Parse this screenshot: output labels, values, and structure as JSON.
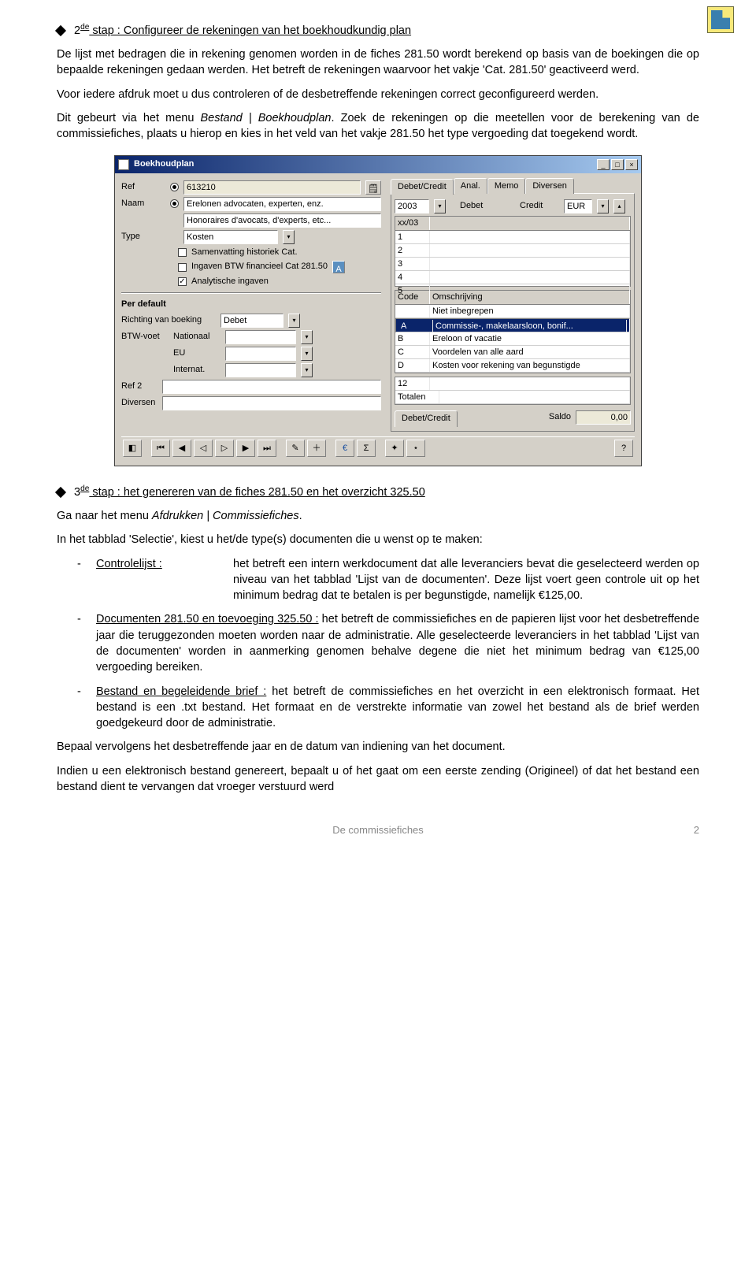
{
  "page_icon": "document-tools-icon",
  "step2": {
    "prefix": "2",
    "sup": "de",
    "title": " stap : Configureer de rekeningen van het boekhoudkundig plan",
    "p1": "De lijst met bedragen die in rekening genomen worden in de fiches 281.50 wordt berekend op basis van de boekingen die op bepaalde rekeningen gedaan werden.  Het betreft de rekeningen waarvoor het vakje 'Cat. 281.50' geactiveerd werd.",
    "p2": "Voor iedere afdruk moet u dus controleren of de desbetreffende rekeningen correct geconfigureerd werden.",
    "p3a": "Dit gebeurt via het menu ",
    "p3_italic": "Bestand | Boekhoudplan",
    "p3b": ".  Zoek de rekeningen op die meetellen voor de berekening van de commissiefiches,  plaats u hierop en kies in het veld van het vakje  281.50 het type vergoeding dat toegekend wordt."
  },
  "win": {
    "title": "Boekhoudplan",
    "min": "_",
    "max": "□",
    "close": "×",
    "ref_lbl": "Ref",
    "ref_val": "613210",
    "naam_lbl": "Naam",
    "naam1": "Erelonen advocaten, experten, enz.",
    "naam2": "Honoraires d'avocats, d'experts, etc...",
    "type_lbl": "Type",
    "type_val": "Kosten",
    "chk1": "Samenvatting historiek  Cat.",
    "chk2": "Ingaven BTW financieel Cat 281.50",
    "chk3": "Analytische ingaven",
    "perdef": "Per default",
    "rvb_lbl": "Richting van boeking",
    "rvb_val": "Debet",
    "btw_lbl": "BTW-voet",
    "btw_nat": "Nationaal",
    "btw_eu": "EU",
    "btw_int": "Internat.",
    "ref2_lbl": "Ref 2",
    "div_lbl": "Diversen",
    "tabs": [
      "Debet/Credit",
      "Anal.",
      "Memo",
      "Diversen"
    ],
    "year": "2003",
    "dc_debet": "Debet",
    "dc_credit": "Credit",
    "cur": "EUR",
    "col_yr": "xx/03",
    "code_hdr": "Code",
    "oms_hdr": "Omschrijving",
    "codes": [
      {
        "c": "",
        "o": "Niet inbegrepen"
      },
      {
        "c": "A",
        "o": "Commissie-, makelaarsloon, bonif..."
      },
      {
        "c": "B",
        "o": "Ereloon of vacatie"
      },
      {
        "c": "C",
        "o": "Voordelen van alle aard"
      },
      {
        "c": "D",
        "o": "Kosten voor rekening van begunstigde"
      }
    ],
    "row12": "12",
    "totalen": "Totalen",
    "saldo_lbl": "Saldo",
    "saldo_val": "0,00",
    "tabs2": "Debet/Credit",
    "nav": [
      "◧",
      "⏮",
      "◀",
      "◁",
      "▷",
      "▶",
      "⏭",
      "✎",
      "＋",
      "€",
      "Σ",
      "✦",
      "⋆"
    ],
    "nav_names": [
      "layout-icon",
      "first-icon",
      "prev-page-icon",
      "prev-icon",
      "next-icon",
      "next-page-icon",
      "last-icon",
      "edit-icon",
      "add-icon",
      "euro-icon",
      "sigma-icon",
      "sparkle-icon",
      "star-icon"
    ],
    "help": "?"
  },
  "step3": {
    "prefix": "3",
    "sup": "de",
    "title": " stap : het genereren van de fiches 281.50 en het overzicht 325.50",
    "p1a": "Ga naar het menu ",
    "p1_italic": "Afdrukken | Commissiefiches",
    "p1b": ".",
    "p2": "In het tabblad 'Selectie', kiest u het/de type(s) documenten die u wenst op te maken:",
    "items": [
      {
        "label": "Controlelijst :",
        "body": "het betreft een intern werkdocument dat alle leveranciers bevat die geselecteerd werden op niveau van het tabblad 'Lijst van de documenten'.  Deze lijst voert geen controle uit op het minimum bedrag dat te betalen is per begunstigde, namelijk €125,00."
      },
      {
        "label": "Documenten 281.50 en toevoeging 325.50 :",
        "body": " het betreft de commissiefiches en de papieren lijst voor het desbetreffende jaar die teruggezonden moeten worden naar de administratie.  Alle geselecteerde leveranciers in het tabblad  'Lijst van de documenten' worden in aanmerking genomen behalve degene die niet het minimum bedrag van €125,00 vergoeding bereiken."
      },
      {
        "label": "Bestand en begeleidende brief :",
        "body": " het betreft de commissiefiches en het overzicht in een elektronisch formaat.  Het bestand is een .txt bestand.  Het formaat en de verstrekte informatie van zowel het bestand als de brief  werden goedgekeurd door de administratie."
      }
    ],
    "p3": "Bepaal vervolgens het desbetreffende jaar en de datum van indiening van het document.",
    "p4": "Indien u een elektronisch bestand genereert, bepaalt u of het gaat om een eerste zending (Origineel) of dat het bestand een bestand dient te vervangen dat vroeger verstuurd werd"
  },
  "footer": {
    "center": "De commissiefiches",
    "right": "2"
  }
}
